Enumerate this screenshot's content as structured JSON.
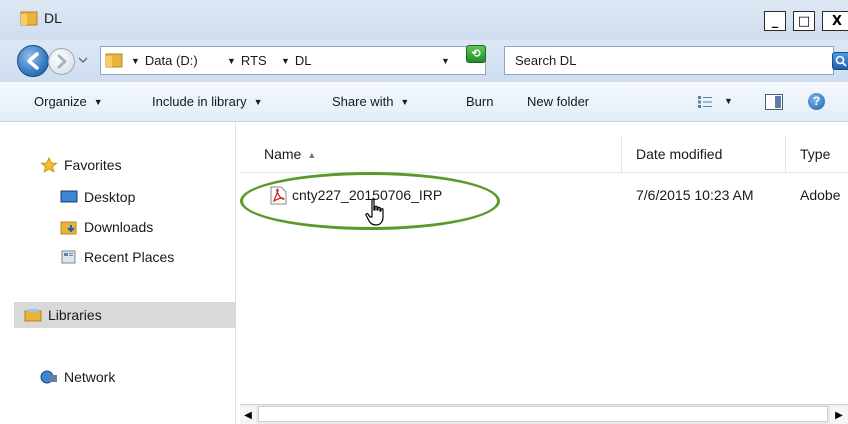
{
  "window": {
    "title": "DL",
    "controls": {
      "minimize": "_",
      "maximize": "□",
      "close": "X"
    }
  },
  "address_bar": {
    "breadcrumbs": [
      "Data (D:)",
      "RTS",
      "DL"
    ],
    "search_placeholder": "Search DL"
  },
  "command_bar": {
    "organize": "Organize",
    "include_in_library": "Include in library",
    "share_with": "Share with",
    "burn": "Burn",
    "new_folder": "New folder"
  },
  "nav_pane": {
    "favorites": "Favorites",
    "desktop": "Desktop",
    "downloads": "Downloads",
    "recent_places": "Recent Places",
    "libraries": "Libraries",
    "network": "Network"
  },
  "file_list": {
    "columns": {
      "name": "Name",
      "date_modified": "Date modified",
      "type": "Type"
    },
    "rows": [
      {
        "name": "cnty227_20150706_IRP",
        "date_modified": "7/6/2015 10:23 AM",
        "type": "Adobe"
      }
    ]
  },
  "colors": {
    "highlight": "#5a9a2a",
    "selected_nav": "#d9d9d9"
  },
  "icons": {
    "file": "pdf-icon",
    "cursor": "hand-pointer-icon"
  }
}
